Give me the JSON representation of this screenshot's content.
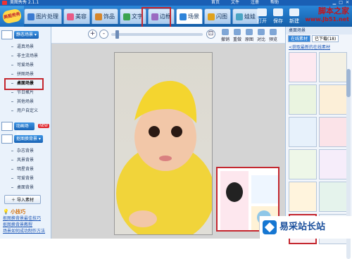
{
  "app": {
    "title": "美图秀秀 2.1.1"
  },
  "window_menu": [
    "首页",
    "文件",
    "注册",
    "帮助"
  ],
  "brand": {
    "label": "美图秀秀"
  },
  "tabs": [
    {
      "label": "图片处理",
      "color": "#3a7ad1"
    },
    {
      "label": "美容",
      "color": "#e85a86"
    },
    {
      "label": "饰品",
      "color": "#d6862b"
    },
    {
      "label": "文字",
      "color": "#3ba34f"
    },
    {
      "label": "边框",
      "color": "#9a6ac1"
    },
    {
      "label": "场景",
      "color": "#2f84d9"
    },
    {
      "label": "闪图",
      "color": "#e0a21c"
    },
    {
      "label": "娃娃",
      "color": "#4aa4c4"
    }
  ],
  "right_buttons": {
    "open": "打开",
    "save": "保存",
    "new": "新建"
  },
  "watermark": {
    "line1": "脚本之家",
    "line2": "www.Jb51.net"
  },
  "sidebar": {
    "scene_button": "静态场景",
    "scene_items": [
      "逼真场景",
      "非主流场景",
      "可爱场景",
      "拼图场景",
      "桌面场景",
      "节日聚片",
      "其他场景",
      "用户自定义"
    ],
    "anim_button": "动画场景",
    "new_badge": "NEW",
    "bg_button": "抠图换背景",
    "bg_items": [
      "杂志背景",
      "风景背景",
      "明星背景",
      "可爱背景",
      "桌面背景"
    ],
    "import_label": "导入素材",
    "tips_title": "小技巧",
    "tips": [
      "抠图换背景最佳技巧",
      "抠图换背景教程",
      "场景如何成功制作方法"
    ]
  },
  "toolbar": {
    "zoom_in": "+",
    "zoom_out": "-",
    "undo": "撤销",
    "redo": "重做",
    "reset": "原图",
    "compare": "对比",
    "preview": "预览"
  },
  "right_panel": {
    "title": "桌面场景",
    "tab_online": "在线素材",
    "tab_downloaded": "已下载(18)",
    "link": "<获取最新的在线素材"
  }
}
